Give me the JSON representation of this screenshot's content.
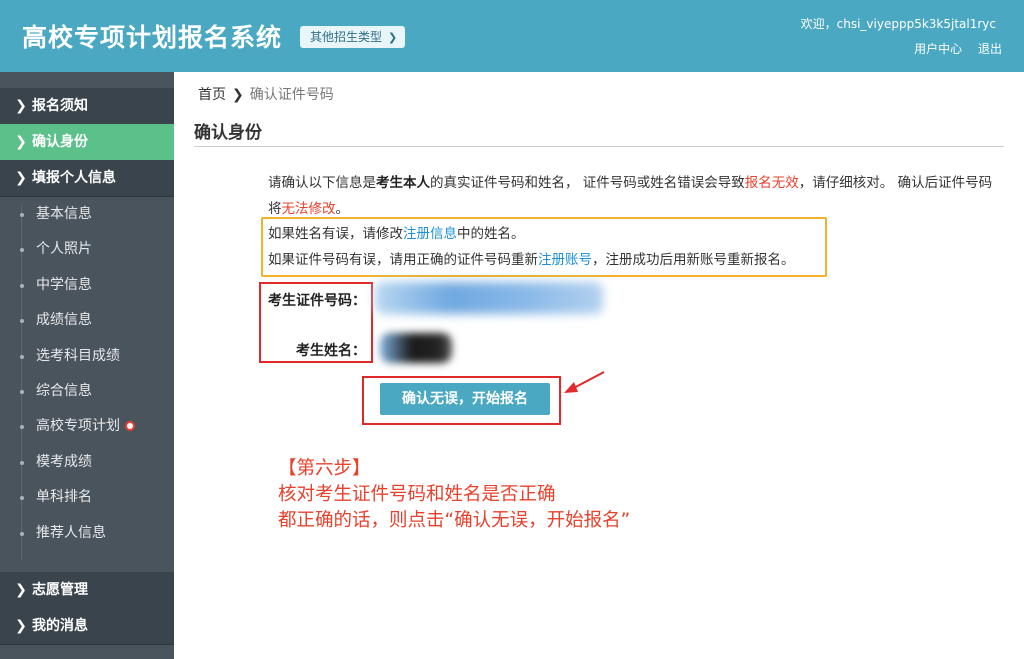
{
  "header": {
    "title": "高校专项计划报名系统",
    "other_types": "其他招生类型",
    "welcome": "欢迎，chsi_viyeppp5k3k5jtal1ryc",
    "user_center": "用户中心",
    "logout": "退出"
  },
  "sidebar": {
    "sections": [
      {
        "label": "报名须知"
      },
      {
        "label": "确认身份",
        "active": true
      },
      {
        "label": "填报个人信息"
      }
    ],
    "sub_items": [
      {
        "label": "基本信息"
      },
      {
        "label": "个人照片"
      },
      {
        "label": "中学信息"
      },
      {
        "label": "成绩信息"
      },
      {
        "label": "选考科目成绩"
      },
      {
        "label": "综合信息"
      },
      {
        "label": "高校专项计划"
      },
      {
        "label": "模考成绩"
      },
      {
        "label": "单科排名"
      },
      {
        "label": "推荐人信息"
      }
    ],
    "bottom_sections": [
      {
        "label": "志愿管理"
      },
      {
        "label": "我的消息"
      }
    ]
  },
  "breadcrumb": {
    "home": "首页",
    "current": "确认证件号码"
  },
  "page": {
    "title": "确认身份",
    "notice": {
      "p1": "请确认以下信息是",
      "b1": "考生本人",
      "p2": "的真实证件号码和姓名， 证件号码或姓名错误会导致",
      "r1": "报名无效",
      "p3": "，请仔细核对。 确认后证件号码将",
      "r2": "无法修改",
      "p4": "。"
    },
    "hint1": {
      "a": "如果姓名有误，请修改",
      "link": "注册信息",
      "b": "中的姓名。"
    },
    "hint2": {
      "a": "如果证件号码有误，请用正确的证件号码重新",
      "link": "注册账号",
      "b": "，注册成功后用新账号重新报名。"
    },
    "id_label": "考生证件号码：",
    "name_label": "考生姓名：",
    "confirm_button": "确认无误，开始报名"
  },
  "annotation": {
    "line1": "【第六步】",
    "line2": "核对考生证件号码和姓名是否正确",
    "line3": "都正确的话，则点击“确认无误，开始报名”"
  }
}
